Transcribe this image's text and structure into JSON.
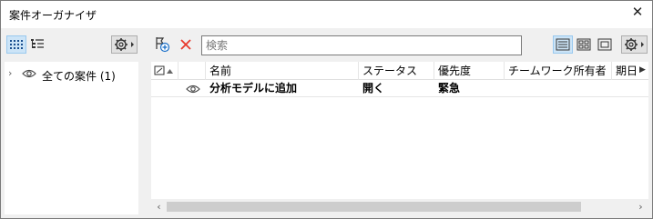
{
  "window": {
    "title": "案件オーガナイザ"
  },
  "left": {
    "tree": [
      {
        "label": "全ての案件 (1)"
      }
    ]
  },
  "search": {
    "placeholder": "検索"
  },
  "table": {
    "columns": [
      "名前",
      "ステータス",
      "優先度",
      "チームワーク所有者",
      "期日"
    ],
    "rows": [
      {
        "name": "分析モデルに追加",
        "status": "開く",
        "priority": "緊急",
        "owner": "",
        "due": ""
      }
    ]
  },
  "colors": {
    "active_button_bg": "#cce4f7",
    "active_button_border": "#99c9ef",
    "delete_icon": "#e8392c",
    "add_icon": "#1a6fc8"
  },
  "icons": [
    "close-icon",
    "tile-view-icon",
    "tree-view-icon",
    "settings-icon",
    "add-issue-icon",
    "delete-icon",
    "list-view-icon",
    "grid-view-icon",
    "single-view-icon",
    "eye-icon",
    "chevron-right-icon"
  ]
}
